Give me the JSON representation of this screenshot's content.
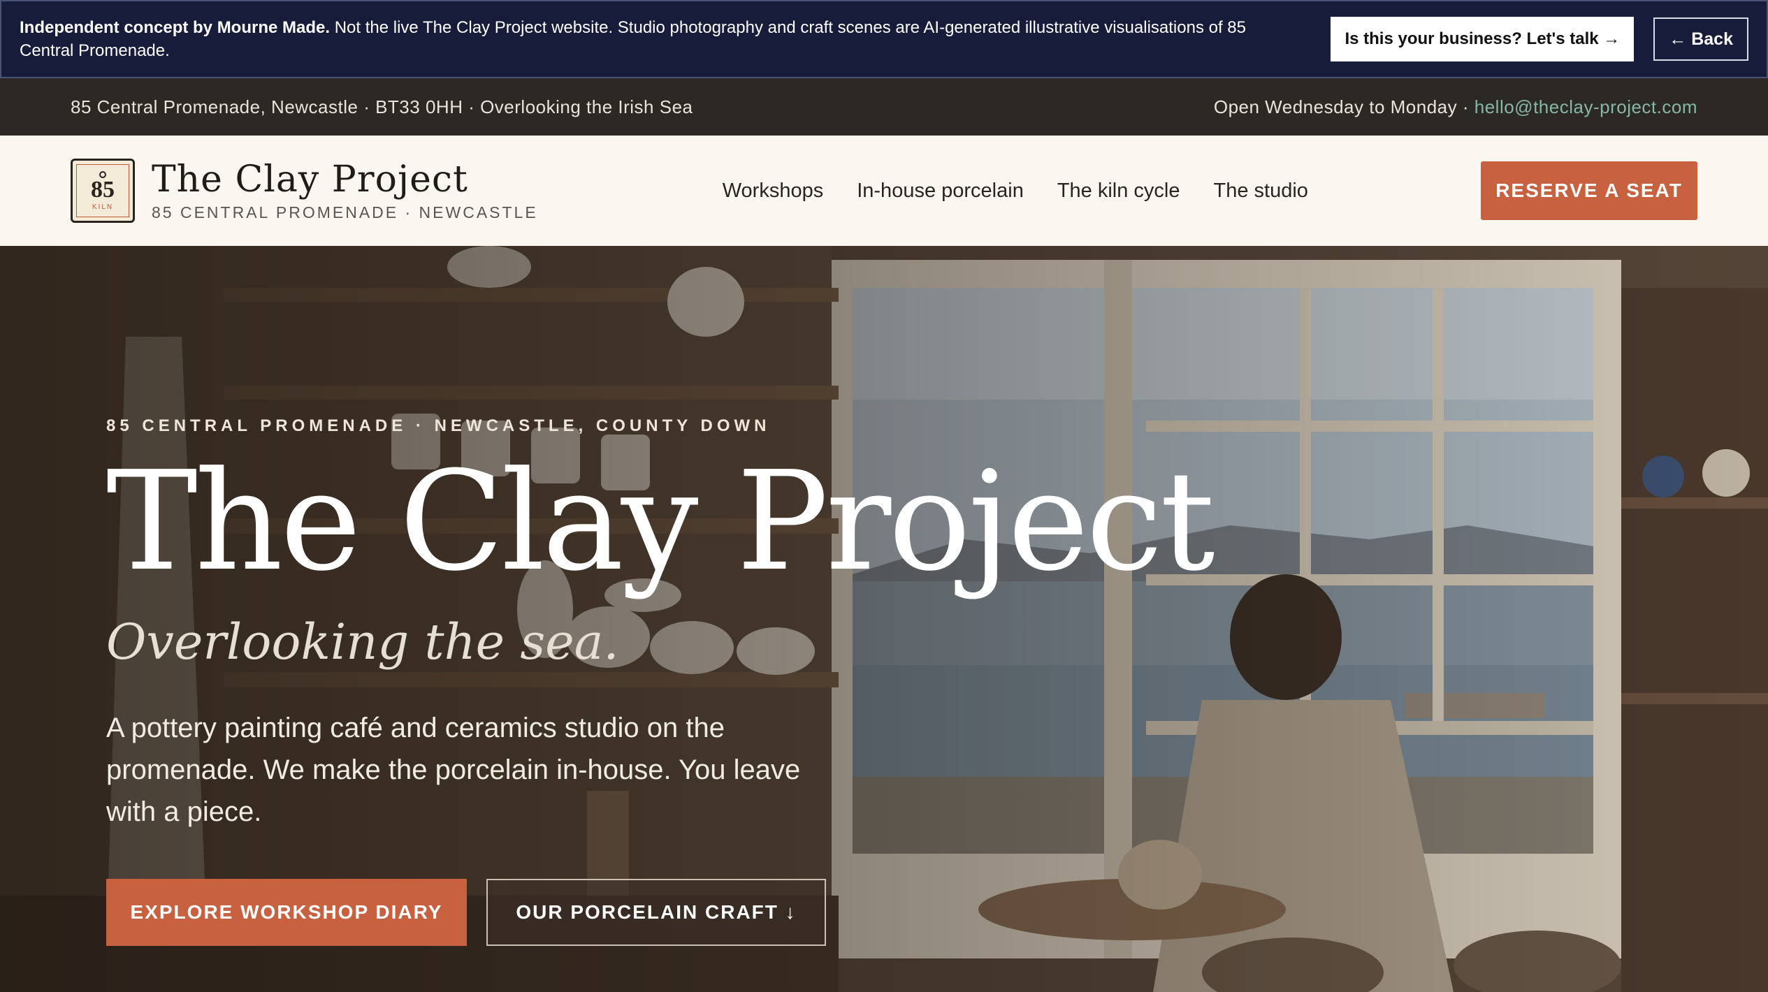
{
  "concept": {
    "lead": "Independent concept by Mourne Made.",
    "text": "Not the live The Clay Project website. Studio photography and craft scenes are AI-generated illustrative visualisations of 85 Central Promenade.",
    "talk_label": "Is this your business? Let's talk →",
    "back_label": "← Back"
  },
  "info": {
    "address": "85 Central Promenade, Newcastle · BT33 0HH · Overlooking the Irish Sea",
    "hours": "Open Wednesday to Monday · ",
    "email": "hello@theclay-project.com"
  },
  "header": {
    "logo_number": "85",
    "logo_sub": "KILN",
    "brand_name": "The Clay Project",
    "brand_sub": "85 CENTRAL PROMENADE · NEWCASTLE",
    "nav": [
      "Workshops",
      "In-house porcelain",
      "The kiln cycle",
      "The studio"
    ],
    "reserve_label": "RESERVE A SEAT"
  },
  "hero": {
    "eyebrow": "85 CENTRAL PROMENADE · NEWCASTLE, COUNTY DOWN",
    "title": "The Clay Project",
    "tagline": "Overlooking the sea.",
    "description": "A pottery painting café and ceramics studio on the promenade. We make the porcelain in-house. You leave with a piece.",
    "primary_label": "EXPLORE WORKSHOP DIARY",
    "secondary_label": "OUR PORCELAIN CRAFT ↓"
  },
  "colors": {
    "accent": "#c8613f",
    "banner": "#171c3a",
    "info_bar": "#2c2823",
    "header_bg": "#faf7f1",
    "email_link": "#86b7a8"
  }
}
